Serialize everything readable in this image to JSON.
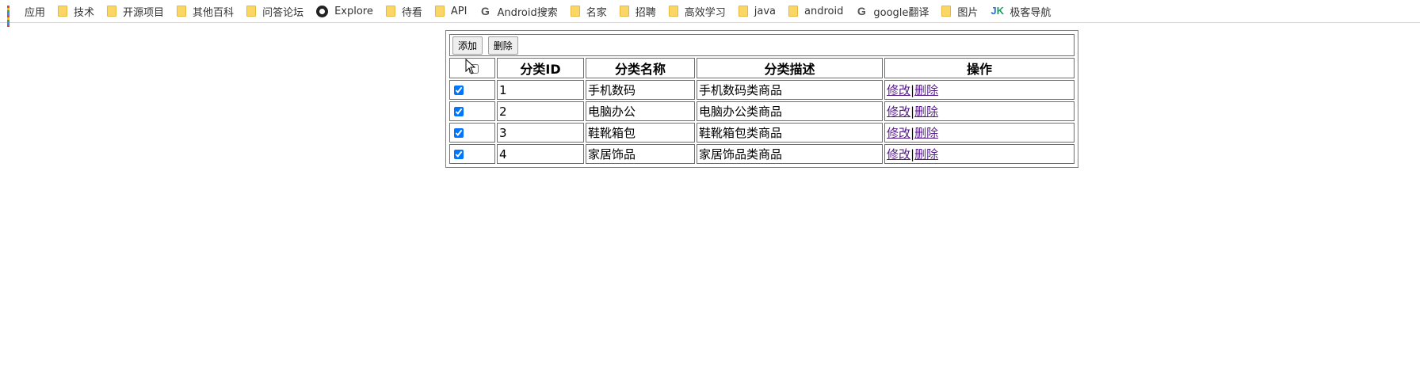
{
  "bookmarks": [
    {
      "icon": "apps-icon",
      "label": "应用"
    },
    {
      "icon": "folder-icon",
      "label": "技术"
    },
    {
      "icon": "folder-icon",
      "label": "开源项目"
    },
    {
      "icon": "folder-icon",
      "label": "其他百科"
    },
    {
      "icon": "folder-icon",
      "label": "问答论坛"
    },
    {
      "icon": "github-icon",
      "label": "Explore"
    },
    {
      "icon": "folder-icon",
      "label": "待看"
    },
    {
      "icon": "folder-icon",
      "label": "API"
    },
    {
      "icon": "google-icon",
      "label": "Android搜索"
    },
    {
      "icon": "folder-icon",
      "label": "名家"
    },
    {
      "icon": "folder-icon",
      "label": "招聘"
    },
    {
      "icon": "folder-icon",
      "label": "高效学习"
    },
    {
      "icon": "folder-icon",
      "label": "java"
    },
    {
      "icon": "folder-icon",
      "label": "android"
    },
    {
      "icon": "google-icon",
      "label": "google翻译"
    },
    {
      "icon": "folder-icon",
      "label": "图片"
    },
    {
      "icon": "jk-icon",
      "label": "极客导航"
    }
  ],
  "toolbar": {
    "add_label": "添加",
    "delete_label": "删除"
  },
  "table": {
    "headers": [
      "",
      "分类ID",
      "分类名称",
      "分类描述",
      "操作"
    ],
    "rows": [
      {
        "checked": true,
        "id": "1",
        "name": "手机数码",
        "desc": "手机数码类商品",
        "edit": "修改",
        "sep": "|",
        "del": "删除"
      },
      {
        "checked": true,
        "id": "2",
        "name": "电脑办公",
        "desc": "电脑办公类商品",
        "edit": "修改",
        "sep": "|",
        "del": "删除"
      },
      {
        "checked": true,
        "id": "3",
        "name": "鞋靴箱包",
        "desc": "鞋靴箱包类商品",
        "edit": "修改",
        "sep": "|",
        "del": "删除"
      },
      {
        "checked": true,
        "id": "4",
        "name": "家居饰品",
        "desc": "家居饰品类商品",
        "edit": "修改",
        "sep": "|",
        "del": "删除"
      }
    ]
  },
  "colors": {
    "link_visited": "#551a8b",
    "folder": "#f9d665",
    "apps_dots": [
      "#ea4335",
      "#fbbc05",
      "#34a853",
      "#4285f4"
    ]
  }
}
